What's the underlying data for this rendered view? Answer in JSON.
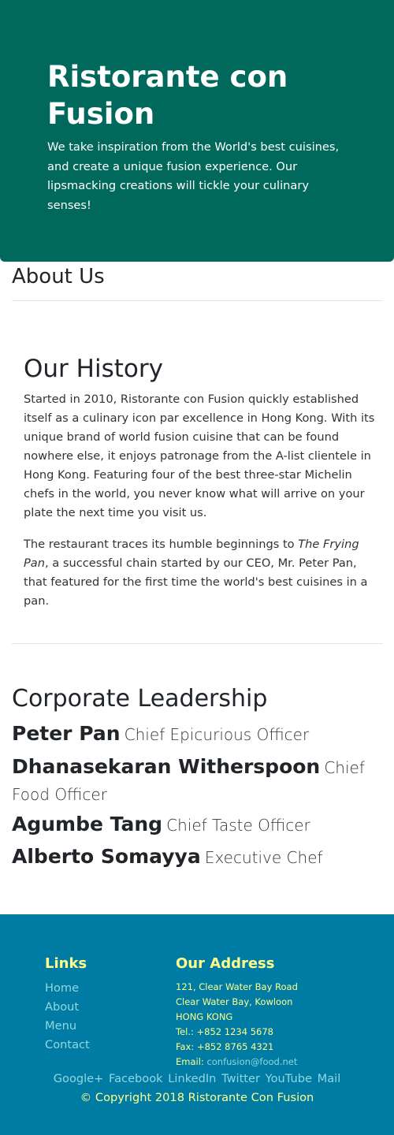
{
  "jumbotron": {
    "title": "Ristorante con Fusion",
    "text": "We take inspiration from the World's best cuisines, and create a unique fusion experience. Our lipsmacking creations will tickle your culinary senses!"
  },
  "about": {
    "heading": "About Us"
  },
  "history": {
    "heading": "Our History",
    "p1": "Started in 2010, Ristorante con Fusion quickly established itself as a culinary icon par excellence in Hong Kong. With its unique brand of world fusion cuisine that can be found nowhere else, it enjoys patronage from the A-list clientele in Hong Kong. Featuring four of the best three-star Michelin chefs in the world, you never know what will arrive on your plate the next time you visit us.",
    "p2_before": "The restaurant traces its humble beginnings to ",
    "p2_italic": "The Frying Pan",
    "p2_after": ", a successful chain started by our CEO, Mr. Peter Pan, that featured for the first time the world's best cuisines in a pan."
  },
  "leadership": {
    "heading": "Corporate Leadership",
    "leaders": [
      {
        "name": "Peter Pan",
        "role": "Chief Epicurious Officer"
      },
      {
        "name": "Dhanasekaran Witherspoon",
        "role": "Chief Food Officer"
      },
      {
        "name": "Agumbe Tang",
        "role": "Chief Taste Officer"
      },
      {
        "name": "Alberto Somayya",
        "role": "Executive Chef"
      }
    ]
  },
  "footer": {
    "links_heading": "Links",
    "links": [
      "Home",
      "About",
      "Menu",
      "Contact"
    ],
    "address_heading": "Our Address",
    "address_lines": [
      "121, Clear Water Bay Road",
      "Clear Water Bay, Kowloon",
      "HONG KONG"
    ],
    "tel": "Tel.: +852 1234 5678",
    "fax": "Fax: +852 8765 4321",
    "email_label": "Email: ",
    "email": "confusion@food.net",
    "social": [
      "Google+",
      "Facebook",
      "LinkedIn",
      "Twitter",
      "YouTube",
      "Mail"
    ],
    "copyright": "© Copyright 2018 Ristorante Con Fusion"
  },
  "colors": {
    "jumbotron_bg": "#00695c",
    "footer_bg": "#007ba3",
    "footer_heading": "#ffff8d",
    "footer_link": "#8fd8e0"
  }
}
